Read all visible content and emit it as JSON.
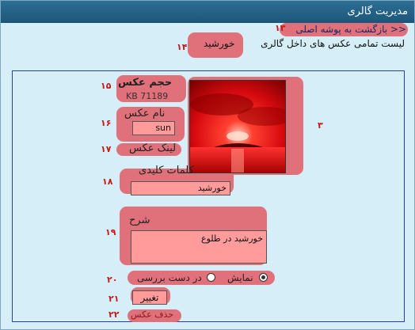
{
  "window": {
    "title": "مدیریت گالری"
  },
  "header": {
    "back_link": "<< بازگشت به پوشه اصلی",
    "subtitle": "لیست تمامی عکس های داخل گالری",
    "gallery_name": "خورشید"
  },
  "photo": {
    "size_label": "حجم عکس",
    "size_value": "KB 71189",
    "name_label": "نام عکس",
    "name_value": "sun",
    "link_label": "لینک عکس",
    "keywords_label": "کلمات کلیدی",
    "keywords_value": "خورشید",
    "description_label": "شرح",
    "description_value": "خورشید در طلوع",
    "status_show_label": "نمایش",
    "status_review_label": "در دست بررسی",
    "status_selected": "نمایش",
    "change_button": "تغییر",
    "delete_link": "حذف عکس"
  },
  "markers": [
    "۱۳",
    "۱۴",
    "۱۵",
    "۱۶",
    "۱۷",
    "۱۸",
    "۱۹",
    "۲۰",
    "۲۱",
    "۲۲",
    "۳"
  ],
  "colors": {
    "highlight": "#e0707a",
    "marker": "#c81818",
    "background": "#d6eef8",
    "titlebar": "#1b5679"
  }
}
